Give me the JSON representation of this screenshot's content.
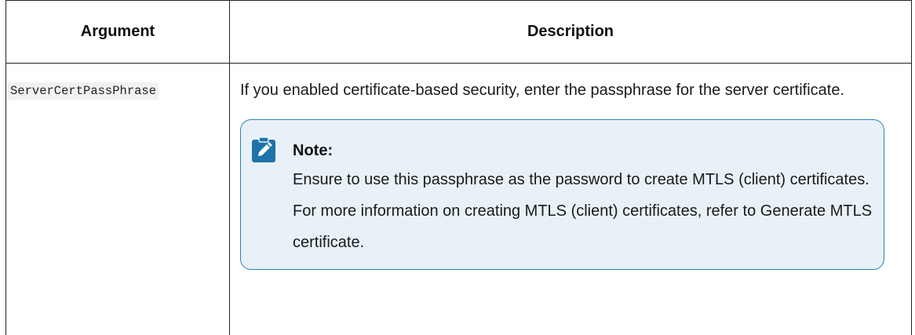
{
  "table": {
    "headers": {
      "argument": "Argument",
      "description": "Description"
    },
    "rows": [
      {
        "argument": "ServerCertPassPhrase",
        "description": "If you enabled certificate-based security, enter the passphrase for the server certificate.",
        "note": {
          "title": "Note:",
          "icon": "note-pencil-icon",
          "body": "Ensure to use this passphrase as the password to create MTLS (client) certificates. For more information on creating MTLS (client) certificates, refer to Generate MTLS certificate."
        }
      }
    ]
  },
  "colors": {
    "note_border": "#2b84b5",
    "note_background": "#e8f1f7",
    "note_icon": "#1f73a8",
    "code_background": "#f1f1f1"
  }
}
